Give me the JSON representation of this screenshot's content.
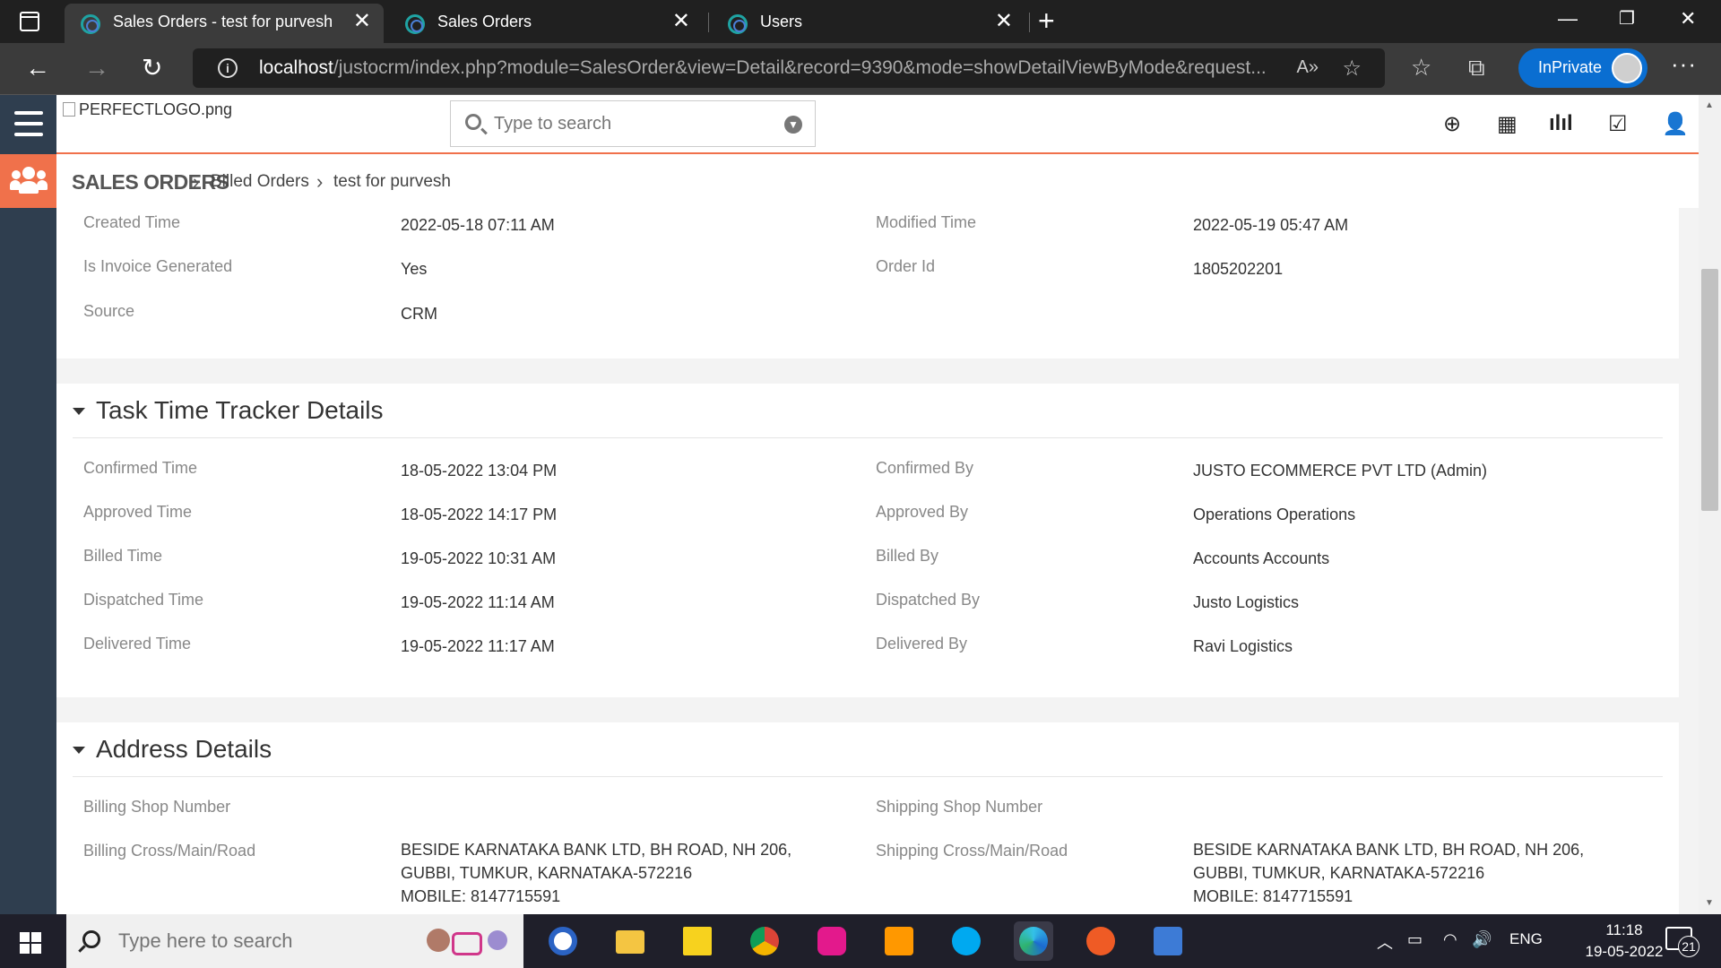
{
  "browser": {
    "tabs": [
      {
        "title": "Sales Orders - test for purvesh",
        "active": true
      },
      {
        "title": "Sales Orders",
        "active": false
      },
      {
        "title": "Users",
        "active": false
      }
    ],
    "url_host": "localhost",
    "url_path": "/justocrm/index.php?module=SalesOrder&view=Detail&record=9390&mode=showDetailViewByMode&request...",
    "inprivate_label": "InPrivate",
    "accent": "#0a6ed1"
  },
  "header": {
    "logo_alt": "PERFECTLOGO.png",
    "search_placeholder": "Type to search",
    "accent": "#f0714b"
  },
  "breadcrumb": {
    "module": "SALES ORDERS",
    "view": "Billed Orders",
    "record": "test for purvesh"
  },
  "details_top": {
    "rows": [
      {
        "l1": "Created Time",
        "v1": "2022-05-18 07:11 AM",
        "l2": "Modified Time",
        "v2": "2022-05-19 05:47 AM"
      },
      {
        "l1": "Is Invoice Generated",
        "v1": "Yes",
        "l2": "Order Id",
        "v2": "1805202201"
      },
      {
        "l1": "Source",
        "v1": "CRM",
        "l2": "",
        "v2": ""
      }
    ]
  },
  "task_tracker": {
    "title": "Task Time Tracker Details",
    "rows": [
      {
        "l1": "Confirmed Time",
        "v1": "18-05-2022 13:04 PM",
        "l2": "Confirmed By",
        "v2": "JUSTO ECOMMERCE PVT LTD (Admin)"
      },
      {
        "l1": "Approved Time",
        "v1": "18-05-2022 14:17 PM",
        "l2": "Approved By",
        "v2": "Operations Operations"
      },
      {
        "l1": "Billed Time",
        "v1": "19-05-2022 10:31 AM",
        "l2": "Billed By",
        "v2": "Accounts Accounts"
      },
      {
        "l1": "Dispatched Time",
        "v1": "19-05-2022 11:14 AM",
        "l2": "Dispatched By",
        "v2": "Justo Logistics"
      },
      {
        "l1": "Delivered Time",
        "v1": "19-05-2022 11:17 AM",
        "l2": "Delivered By",
        "v2": "Ravi Logistics"
      }
    ]
  },
  "address": {
    "title": "Address Details",
    "rows": [
      {
        "l1": "Billing Shop Number",
        "v1": "",
        "l2": "Shipping Shop Number",
        "v2": ""
      },
      {
        "l1": "Billing Cross/Main/Road",
        "v1_lines": [
          "BESIDE KARNATAKA BANK LTD, BH ROAD, NH 206,",
          "GUBBI, TUMKUR, KARNATAKA-572216",
          "MOBILE: 8147715591"
        ],
        "l2": "Shipping Cross/Main/Road",
        "v2_lines": [
          "BESIDE KARNATAKA BANK LTD, BH ROAD, NH 206,",
          "GUBBI, TUMKUR, KARNATAKA-572216",
          "MOBILE: 8147715591"
        ]
      }
    ]
  },
  "taskbar": {
    "search_placeholder": "Type here to search",
    "lang": "ENG",
    "time": "11:18",
    "date": "19-05-2022",
    "notifications": "21"
  }
}
